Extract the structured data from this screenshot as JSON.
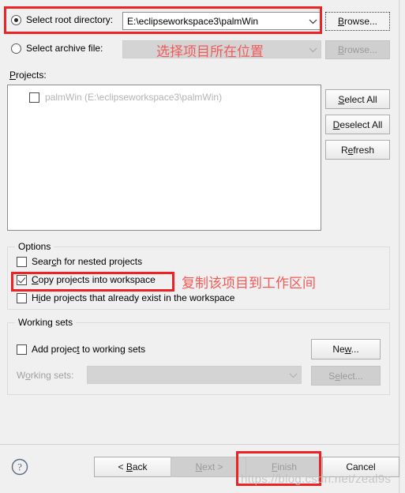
{
  "dialog": {
    "root_dir": {
      "radio_label": "Select root directory:",
      "value": "E:\\eclipseworkspace3\\palmWin",
      "browse_label": "Browse...",
      "selected": true
    },
    "archive": {
      "radio_label": "Select archive file:",
      "value": "",
      "browse_label": "Browse...",
      "selected": false,
      "disabled": true
    },
    "projects": {
      "section_label": "Projects:",
      "items": [
        {
          "label": "palmWin (E:\\eclipseworkspace3\\palmWin)",
          "checked": false
        }
      ],
      "buttons": {
        "select_all": "Select All",
        "deselect_all": "Deselect All",
        "refresh": "Refresh"
      }
    },
    "options": {
      "title": "Options",
      "items": [
        {
          "label": "Search for nested projects",
          "checked": false
        },
        {
          "label": "Copy projects into workspace",
          "checked": true
        },
        {
          "label": "Hide projects that already exist in the workspace",
          "checked": false
        }
      ]
    },
    "working_sets": {
      "title": "Working sets",
      "add_label": "Add project to working sets",
      "add_checked": false,
      "new_button": "New...",
      "field_label": "Working sets:",
      "field_value": "",
      "select_button": "Select..."
    },
    "footer": {
      "help_icon": "question-mark-icon",
      "back": "< Back",
      "next": "Next >",
      "finish": "Finish",
      "cancel": "Cancel"
    }
  },
  "annotations": {
    "accent_color": "#ee2222",
    "text_color": "#f25a5a",
    "note_location": "选择项目所在位置",
    "note_copy": "复制该项目到工作区间",
    "watermark": "https://blog.csdn.net/zeal9s"
  }
}
